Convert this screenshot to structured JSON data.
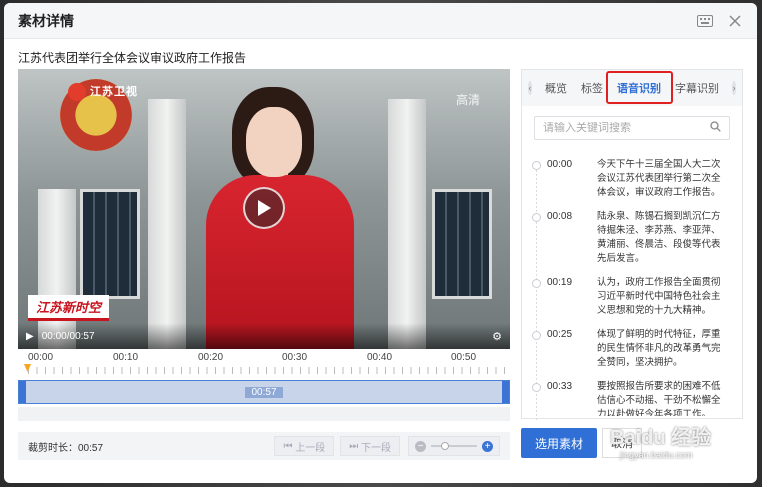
{
  "dialog": {
    "title": "素材详情",
    "subtitle": "江苏代表团举行全体会议审议政府工作报告"
  },
  "video": {
    "channel_logo": "江苏卫视",
    "quality_badge": "高清",
    "lower_third": "江苏新时空",
    "time_display": "00:00/00:57",
    "icons": [
      "play-icon",
      "settings-gear-icon"
    ]
  },
  "timeline": {
    "ruler_labels": [
      "00:00",
      "00:10",
      "00:20",
      "00:30",
      "00:40",
      "00:50"
    ],
    "clip_duration": "00:57"
  },
  "footer": {
    "trim_label": "裁剪时长：",
    "trim_value": "00:57",
    "prev_label": "上一段",
    "next_label": "下一段"
  },
  "panel": {
    "tabs": [
      "概览",
      "标签",
      "语音识别",
      "字幕识别"
    ],
    "active_tab": "语音识别",
    "search_placeholder": "请输入关键词搜索",
    "transcript": [
      {
        "time": "00:00",
        "text": "今天下午十三届全国人大二次会议江苏代表团举行第二次全体会议，审议政府工作报告。"
      },
      {
        "time": "00:08",
        "text": "陆永泉、陈锡石搁到凯沉仁方待掘朱泾、李苏燕、李亚萍、黄浦丽、佟晨洁、段俊等代表先后发言。"
      },
      {
        "time": "00:19",
        "text": "认为，政府工作报告全面贯彻习近平新时代中国特色社会主义思想和党的十九大精神。"
      },
      {
        "time": "00:25",
        "text": "体现了鲜明的时代特征，厚重的民生情怀非凡的改革勇气完全赞同，坚决拥护。"
      },
      {
        "time": "00:33",
        "text": "要按照报告所要求的困难不低估信心不动摇、干劲不松懈全力以赴做好今年各项工作。"
      }
    ]
  },
  "actions": {
    "select_label": "选用素材",
    "cancel_label": "取消"
  },
  "watermark": {
    "brand": "Baidu 经验",
    "url": "jingyan.baidu.com"
  },
  "colors": {
    "accent": "#2f6fd6",
    "highlight_box": "#e02020",
    "news_red": "#c8141e"
  }
}
